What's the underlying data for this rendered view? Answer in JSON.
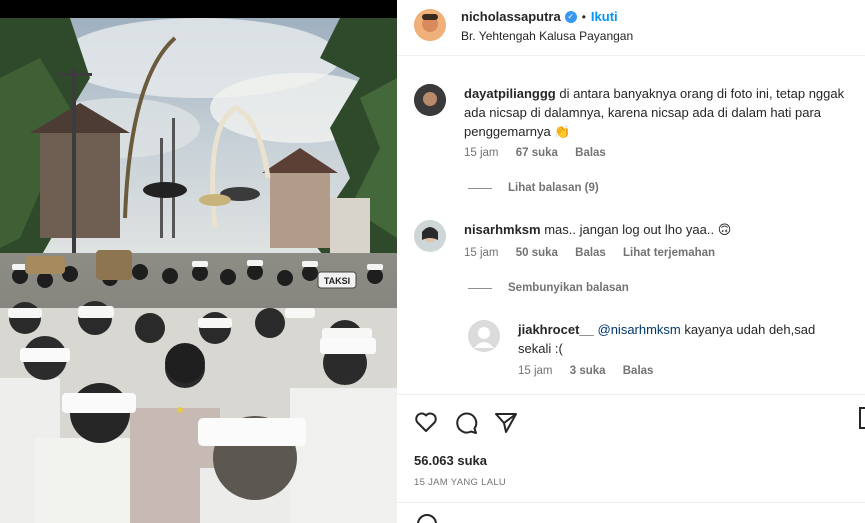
{
  "post": {
    "author": "nicholassaputra",
    "verified": true,
    "follow_label": "Ikuti",
    "location": "Br. Yehtengah Kalusa Payangan"
  },
  "comments": [
    {
      "username": "dayatpilianggg",
      "text": "di antara banyaknya orang di foto ini, tetap nggak ada nicsap di dalamnya, karena nicsap ada di dalam hati para penggemarnya",
      "emoji": "👏",
      "time": "15 jam",
      "likes": "67 suka",
      "reply_label": "Balas",
      "thread_toggle": "Lihat balasan (9)"
    },
    {
      "username": "nisarhmksm",
      "text": "mas.. jangan log out lho yaa..",
      "emoji": "🙃",
      "time": "15 jam",
      "likes": "50 suka",
      "reply_label": "Balas",
      "translate_label": "Lihat terjemahan",
      "thread_toggle": "Sembunyikan balasan",
      "replies": [
        {
          "username": "jiakhrocet__",
          "mention": "@nisarhmksm",
          "text": "kayanya udah deh,sad sekali :(",
          "time": "15 jam",
          "likes": "3 suka",
          "reply_label": "Balas"
        }
      ]
    }
  ],
  "actions": {
    "icons": [
      "heart-icon",
      "comment-icon",
      "share-icon",
      "bookmark-icon"
    ],
    "likes": "56.063 suka",
    "posted": "15 JAM YANG LALU"
  },
  "photo": {
    "sign_text": "TAKSI"
  },
  "colors": {
    "link_blue": "#0095f6",
    "mention_blue": "#00376b",
    "muted": "#737373",
    "text": "#262626"
  }
}
